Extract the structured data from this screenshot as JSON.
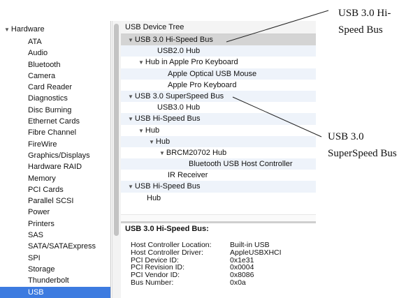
{
  "sidebar": {
    "category": "Hardware",
    "items": [
      "ATA",
      "Audio",
      "Bluetooth",
      "Camera",
      "Card Reader",
      "Diagnostics",
      "Disc Burning",
      "Ethernet Cards",
      "Fibre Channel",
      "FireWire",
      "Graphics/Displays",
      "Hardware RAID",
      "Memory",
      "PCI Cards",
      "Parallel SCSI",
      "Power",
      "Printers",
      "SAS",
      "SATA/SATAExpress",
      "SPI",
      "Storage",
      "Thunderbolt",
      "USB"
    ],
    "selected": "USB"
  },
  "tree": {
    "header": "USB Device Tree",
    "rows": [
      {
        "label": "USB 3.0 Hi-Speed Bus",
        "depth": 0,
        "expanded": true,
        "selected": true
      },
      {
        "label": "USB2.0 Hub",
        "depth": 2,
        "expanded": false
      },
      {
        "label": "Hub in Apple Pro Keyboard",
        "depth": 1,
        "expanded": true
      },
      {
        "label": "Apple Optical USB Mouse",
        "depth": 3,
        "expanded": false
      },
      {
        "label": "Apple Pro Keyboard",
        "depth": 3,
        "expanded": false
      },
      {
        "label": "USB 3.0 SuperSpeed Bus",
        "depth": 0,
        "expanded": true
      },
      {
        "label": "USB3.0 Hub",
        "depth": 2,
        "expanded": false
      },
      {
        "label": "USB Hi-Speed Bus",
        "depth": 0,
        "expanded": true
      },
      {
        "label": "Hub",
        "depth": 1,
        "expanded": true
      },
      {
        "label": "Hub",
        "depth": 2,
        "expanded": true
      },
      {
        "label": "BRCM20702 Hub",
        "depth": 3,
        "expanded": true
      },
      {
        "label": "Bluetooth USB Host Controller",
        "depth": 5,
        "expanded": false
      },
      {
        "label": "IR Receiver",
        "depth": 3,
        "expanded": false
      },
      {
        "label": "USB Hi-Speed Bus",
        "depth": 0,
        "expanded": true
      },
      {
        "label": "Hub",
        "depth": 1,
        "expanded": false
      }
    ]
  },
  "detail": {
    "title": "USB 3.0 Hi-Speed Bus:",
    "rows": [
      {
        "key": "Host Controller Location:",
        "value": "Built-in USB"
      },
      {
        "key": "Host Controller Driver:",
        "value": "AppleUSBXHCI"
      },
      {
        "key": "PCI Device ID:",
        "value": "0x1e31"
      },
      {
        "key": "PCI Revision ID:",
        "value": "0x0004"
      },
      {
        "key": "PCI Vendor ID:",
        "value": "0x8086"
      },
      {
        "key": "Bus Number:",
        "value": "0x0a"
      }
    ]
  },
  "callouts": {
    "hispeed": {
      "line1": "USB 3.0 Hi-",
      "line2": "Speed Bus"
    },
    "superspeed": {
      "line1": "USB 3.0",
      "line2": "SuperSpeed Bus"
    }
  },
  "colors": {
    "selection": "#3d7be0",
    "alt_row": "#eef3fa",
    "tree_selected": "#d4d4d4"
  }
}
